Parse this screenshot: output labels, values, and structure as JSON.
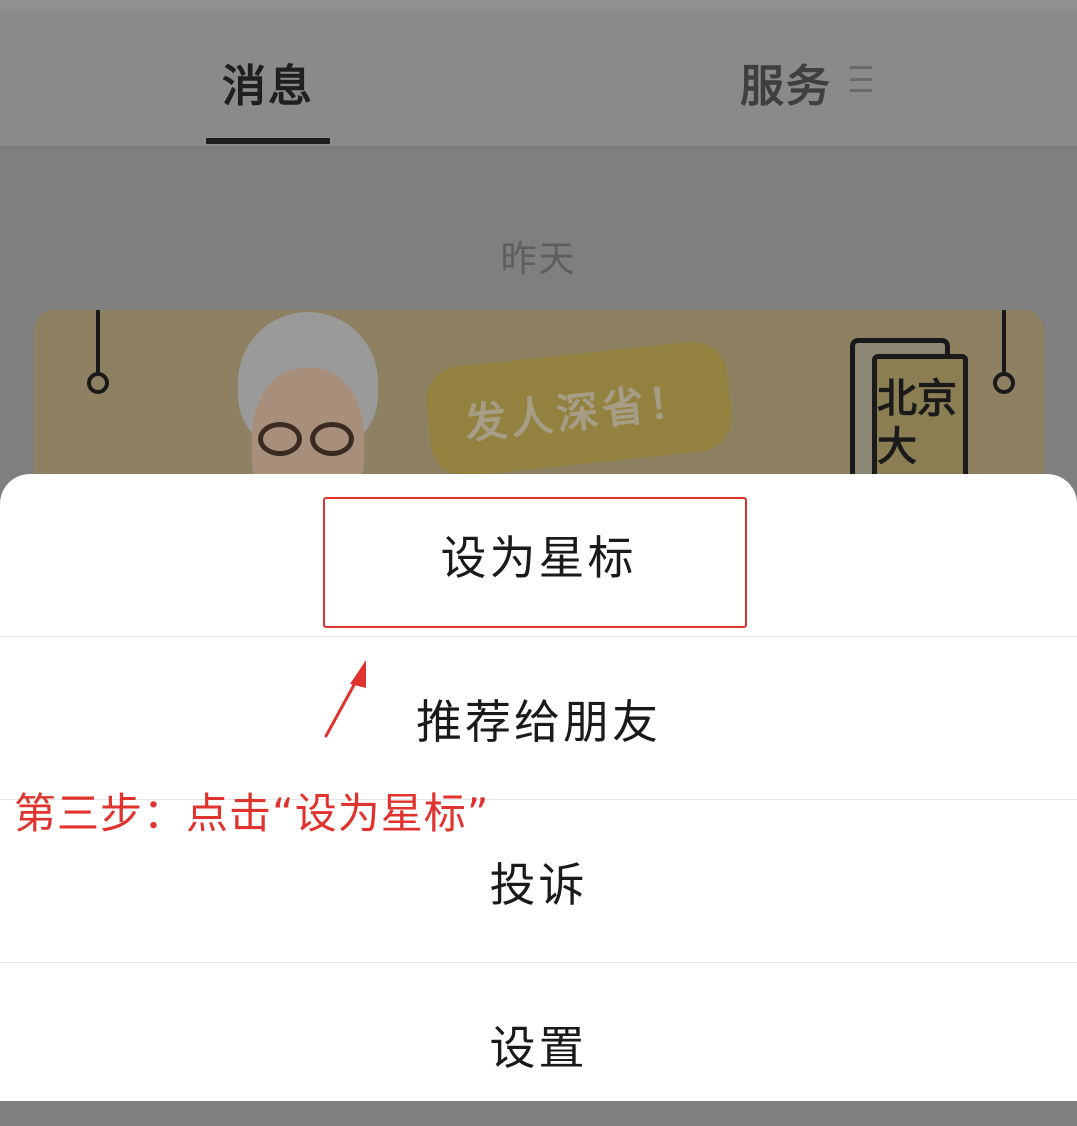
{
  "header": {
    "tabs": [
      {
        "label": "消息",
        "active": true
      },
      {
        "label": "服务",
        "active": false
      }
    ]
  },
  "feed": {
    "date_label": "昨天",
    "banner": {
      "bubble_text": "发人深省！",
      "book_title": "北京大"
    }
  },
  "action_sheet": {
    "items": [
      {
        "label": "设为星标"
      },
      {
        "label": "推荐给朋友"
      },
      {
        "label": "投诉"
      },
      {
        "label": "设置"
      }
    ]
  },
  "annotation": {
    "step_text": "第三步：点击“设为星标”",
    "color": "#e0332e"
  },
  "colors": {
    "overlay_dim": "#7f7f7f",
    "sheet_bg": "#ffffff",
    "annotation_red": "#e0332e"
  }
}
